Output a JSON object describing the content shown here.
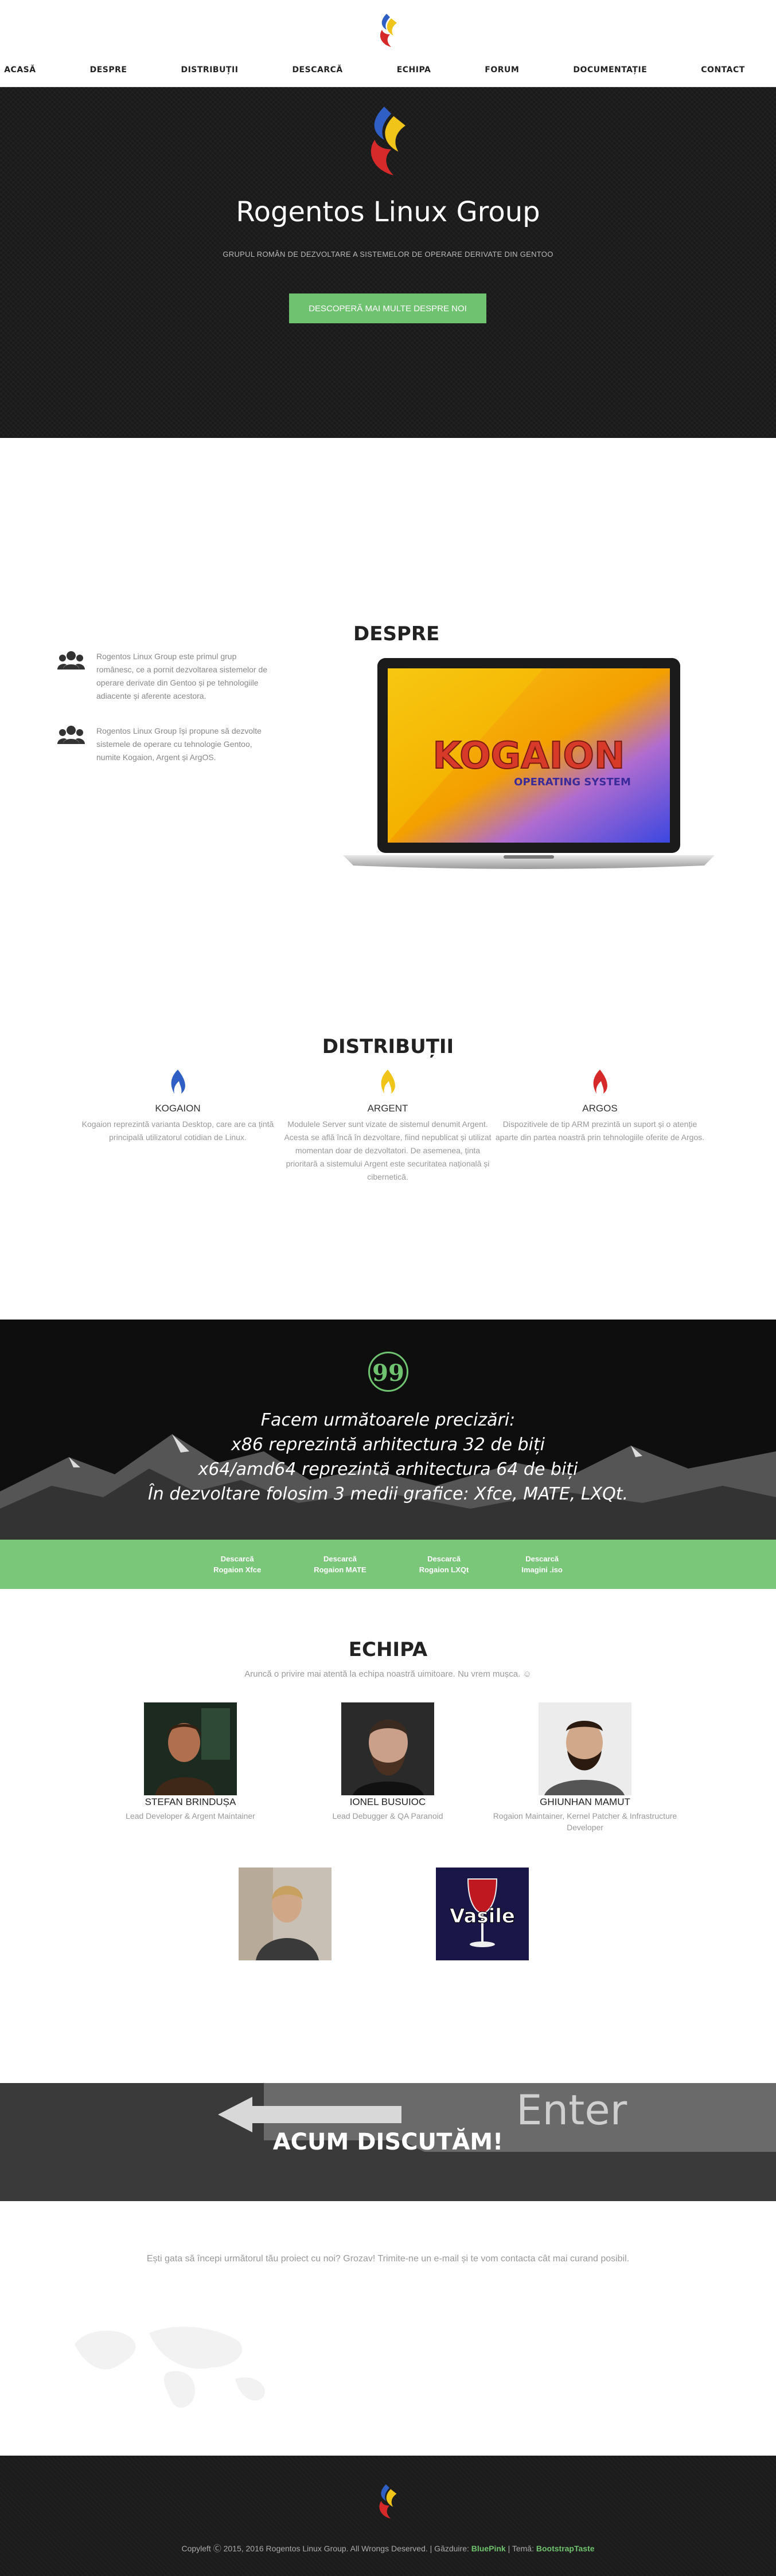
{
  "nav": {
    "items": [
      "ACASĂ",
      "DESPRE",
      "DISTRIBUȚII",
      "DESCARCĂ",
      "ECHIPA",
      "FORUM",
      "DOCUMENTAȚIE",
      "CONTACT"
    ]
  },
  "brand": {
    "logo_icon": "rogentos-flame-logo",
    "colors": {
      "blue": "#2f5fc4",
      "yellow": "#f0c419",
      "red": "#d62a2a",
      "accent_green": "#6fc26f"
    }
  },
  "hero": {
    "title": "Rogentos Linux Group",
    "tagline": "GRUPUL ROMÂN DE DEZVOLTARE A SISTEMELOR DE OPERARE DERIVATE DIN GENTOO",
    "cta": "DESCOPERĂ MAI MULTE DESPRE NOI"
  },
  "despre": {
    "title": "DESPRE",
    "features": [
      {
        "icon": "users-icon",
        "text": "Rogentos Linux Group este primul grup românesc, ce a pornit dezvoltarea sistemelor de operare derivate din Gentoo și pe tehnologiile adiacente și aferente acestora."
      },
      {
        "icon": "users-icon",
        "text": "Rogentos Linux Group își propune să dezvolte sistemele de operare cu tehnologie Gentoo, numite Kogaion, Argent și ArgOS."
      }
    ],
    "laptop_screen_text": "KOGAION",
    "laptop_screen_subtext": "OPERATING SYSTEM"
  },
  "distributii": {
    "title": "DISTRIBUȚII",
    "items": [
      {
        "name": "KOGAION",
        "color": "#2f5fc4",
        "text": "Kogaion reprezintă varianta Desktop, care are ca țintă principală utilizatorul cotidian de Linux."
      },
      {
        "name": "ARGENT",
        "color": "#f0c419",
        "text": "Modulele Server sunt vizate de sistemul denumit Argent. Acesta se află încă în dezvoltare, fiind nepublicat și utilizat momentan doar de dezvoltatori. De asemenea, ținta prioritară a sistemului Argent este securitatea națională și cibernetică."
      },
      {
        "name": "ARGOS",
        "color": "#d62a2a",
        "text": "Dispozitivele de tip ARM prezintă un suport și o atenție aparte din partea noastră prin tehnologiile oferite de Argos."
      }
    ]
  },
  "quote": {
    "icon": "quote-icon",
    "mark": "99",
    "lines": [
      "Facem următoarele precizări:",
      "x86 reprezintă arhitectura 32 de biți",
      "x64/amd64 reprezintă arhitectura 64 de biți",
      "În dezvoltare folosim 3 medii grafice: Xfce, MATE, LXQt."
    ]
  },
  "downloads": [
    {
      "line1": "Descarcă",
      "line2": "Rogaion Xfce"
    },
    {
      "line1": "Descarcă",
      "line2": "Rogaion MATE"
    },
    {
      "line1": "Descarcă",
      "line2": "Rogaion LXQt"
    },
    {
      "line1": "Descarcă",
      "line2": "Imagini .iso"
    }
  ],
  "echipa": {
    "title": "ECHIPA",
    "subtitle": "Aruncă o privire mai atentă la echipa noastră uimitoare. Nu vrem mușca. ☺",
    "members": [
      {
        "name": "STEFAN BRINDUȘA",
        "role": "Lead Developer & Argent Maintainer"
      },
      {
        "name": "IONEL BUSUIOC",
        "role": "Lead Debugger & QA Paranoid"
      },
      {
        "name": "GHIUNHAN MAMUT",
        "role": "Rogaion Maintainer, Kernel Patcher & Infrastructure Developer"
      },
      {
        "name": "",
        "role": ""
      },
      {
        "name": "",
        "role": "",
        "photo_text": "Vasile"
      }
    ]
  },
  "discutam": {
    "title": "ACUM DISCUTĂM!",
    "key_text": "Enter",
    "text": "Ești gata să începi următorul tău proiect cu noi? Grozav! Trimite-ne un e-mail și te vom contacta cât mai curand posibil."
  },
  "footer": {
    "copyright": "Copyleft Ⓒ 2015, 2016 Rogentos Linux Group. All Wrongs Deserved. | Găzduire:",
    "host": "BluePink",
    "separator": "| Temă:",
    "theme": "BootstrapTaste"
  }
}
